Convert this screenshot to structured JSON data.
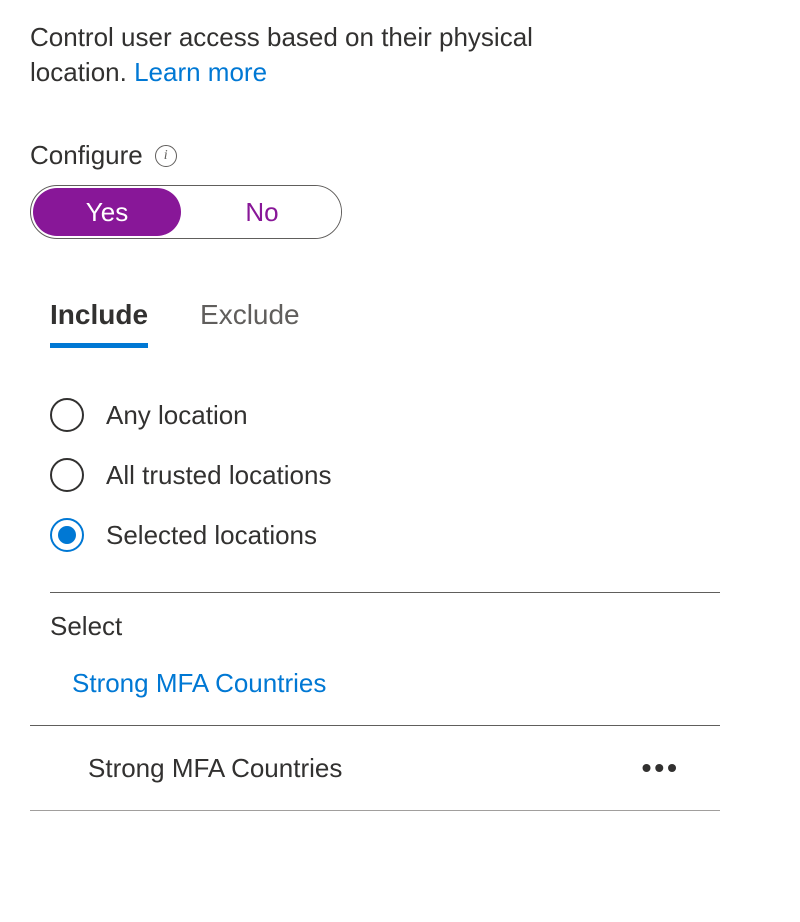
{
  "description": {
    "text": "Control user access based on their physical location. ",
    "learn_more": "Learn more"
  },
  "configure": {
    "label": "Configure",
    "info_glyph": "i",
    "toggle": {
      "yes": "Yes",
      "no": "No",
      "selected": "yes"
    }
  },
  "tabs": {
    "include": "Include",
    "exclude": "Exclude",
    "active": "include"
  },
  "radio_options": {
    "any": "Any location",
    "trusted": "All trusted locations",
    "selected": "Selected locations",
    "chosen": "selected"
  },
  "select_section": {
    "label": "Select",
    "link": "Strong MFA Countries",
    "item": "Strong MFA Countries",
    "more_glyph": "•••"
  }
}
